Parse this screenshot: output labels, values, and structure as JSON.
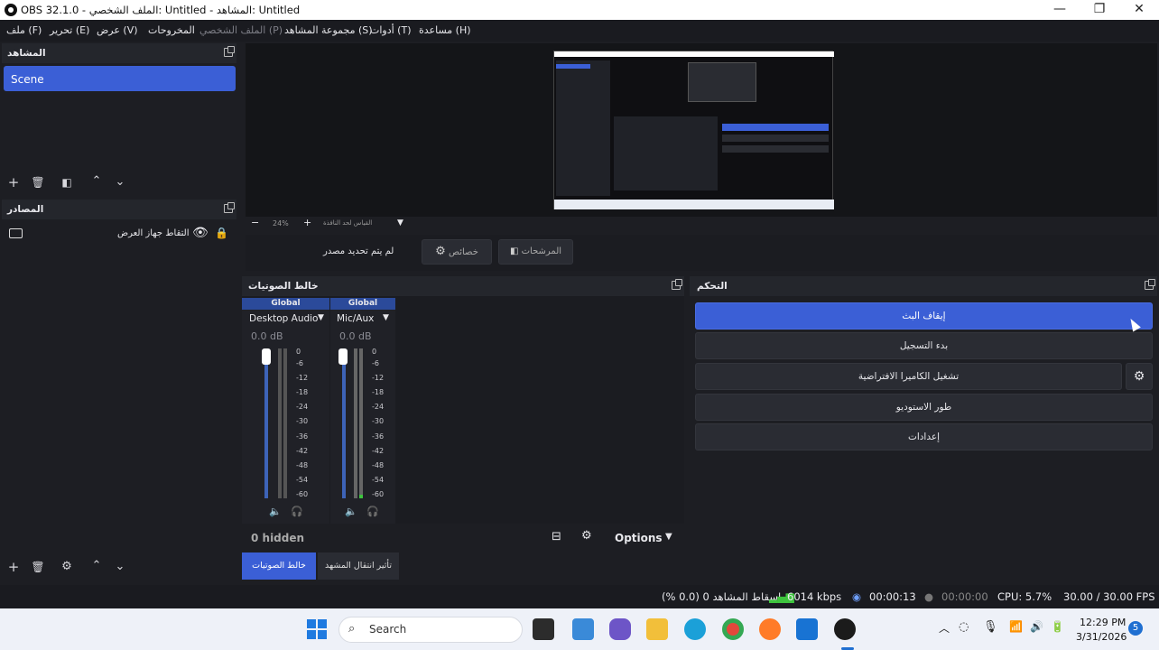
{
  "window": {
    "title": "OBS 32.1.0 - الملف الشخصي: Untitled - المشاهد: Untitled"
  },
  "menu": [
    "ملف (F)",
    "تحرير (E)",
    "عرض (V)",
    "المخروحات",
    "الملف الشخصي (P)",
    "مجموعة المشاهد (S)",
    "أدوات (T)",
    "مساعدة (H)"
  ],
  "scenes": {
    "title": "المشاهد",
    "items": [
      "Scene"
    ]
  },
  "sources": {
    "title": "المصادر",
    "items": [
      {
        "label": "التقاط جهاز العرض"
      }
    ]
  },
  "preview": {
    "zoom": "24%",
    "scale_label": "القياس لحد النافذة"
  },
  "source_toolbar": {
    "no_source": "لم يتم تحديد مصدر",
    "properties": "خصائص",
    "filters": "المرشحات"
  },
  "mixer": {
    "title": "خالط الصوتيات",
    "channels": [
      {
        "tag": "Global",
        "name": "Desktop Audio",
        "db": "0.0 dB"
      },
      {
        "tag": "Global",
        "name": "Mic/Aux",
        "db": "0.0 dB"
      }
    ],
    "scale": [
      "0",
      "-6",
      "-12",
      "-18",
      "-24",
      "-30",
      "-36",
      "-42",
      "-48",
      "-54",
      "-60"
    ],
    "hidden": "0 hidden",
    "options": "Options",
    "tabs": [
      "خالط الصوتيات",
      "تأثير انتقال المشهد"
    ]
  },
  "controls": {
    "title": "التحكم",
    "buttons": [
      "إيقاف البث",
      "بدء التسجيل",
      "تشغيل الكاميرا الافتراضية",
      "طور الاستوديو",
      "إعدادات"
    ]
  },
  "status": {
    "dropped": "إسقاط المشاهد 0 (0.0 %)",
    "bitrate": "6014 kbps",
    "stream_time": "00:00:13",
    "rec_time": "00:00:00",
    "cpu": "CPU: 5.7%",
    "fps": "30.00 / 30.00 FPS"
  },
  "taskbar": {
    "search": "Search",
    "time": "12:29 PM",
    "date": "3/31/2026",
    "badge": "5"
  },
  "colors": {
    "accent": "#3b5fd6",
    "panel": "#1d1e23",
    "title": "#24262c"
  }
}
